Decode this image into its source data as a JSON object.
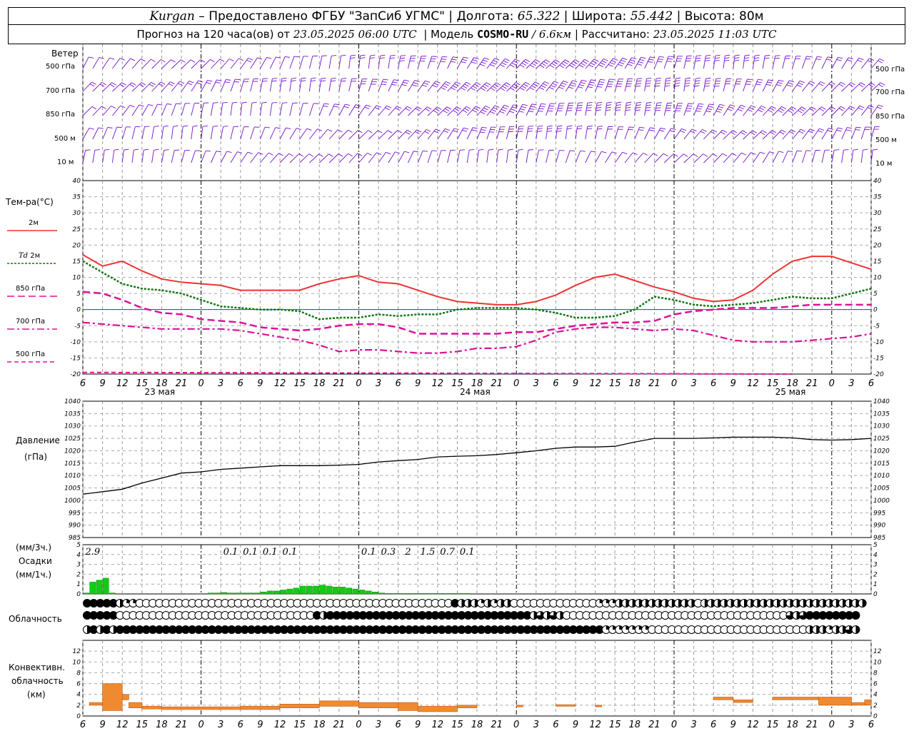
{
  "header": {
    "station": "Kurgan",
    "provider": "– Предоставлено ФГБУ \"ЗапСиб УГМС\"",
    "lon_label": "Долгота:",
    "lon": "65.322",
    "lat_label": "Широта:",
    "lat": "55.442",
    "alt_label": "Высота:",
    "alt": "80м",
    "forecast_label": "Прогноз на 120 часа(ов) от",
    "forecast_from": "23.05.2025 06:00 UTC",
    "model_label": "Модель",
    "model": "COSMO-RU",
    "resolution": "/ 6.6км",
    "calc_label": "Рассчитано:",
    "calc_time": "23.05.2025 11:03 UTC"
  },
  "labels": {
    "wind": "Ветер",
    "wind_levels": [
      "500 гПа",
      "700 гПа",
      "850 гПа",
      "500 м",
      "10 м"
    ],
    "temp": "Тем-ра(°C)",
    "t2m": "2м",
    "td": "Td",
    "td2m": "2м",
    "t850": "850 гПа",
    "t700": "700 гПа",
    "t500": "500 гПа",
    "pressure": "Давление",
    "pressure_unit": "(гПа)",
    "precip_unit1": "(мм/3ч.)",
    "precip": "Осадки",
    "precip_unit2": "(мм/1ч.)",
    "clouds": "Облачность",
    "conv1": "Конвективн.",
    "conv2": "облачность",
    "conv3": "(км)"
  },
  "colors": {
    "temp2m": "#ee3333",
    "dew": "#117711",
    "t850": "#dd1199",
    "wind": "#7711cc",
    "precip": "#11cc11",
    "conv": "#f08a30"
  },
  "time_axis": {
    "ticks": [
      "6",
      "9",
      "12",
      "15",
      "18",
      "21",
      "0",
      "3",
      "6",
      "9",
      "12",
      "15",
      "18",
      "21",
      "0",
      "3",
      "6",
      "9",
      "12",
      "15",
      "18",
      "21",
      "0",
      "3",
      "6",
      "9",
      "12"
    ],
    "dates": [
      "23 мая",
      "24 мая",
      "25 мая"
    ]
  },
  "chart_data": [
    {
      "type": "line",
      "name": "temperature",
      "x": [
        0,
        3,
        6,
        9,
        12,
        15,
        18,
        21,
        24,
        27,
        30,
        33,
        36,
        39,
        42,
        45,
        48,
        51,
        54,
        57,
        60,
        63,
        66,
        69,
        72,
        75,
        78,
        81,
        84,
        87,
        90,
        93,
        96,
        99,
        102,
        105,
        108,
        111,
        114,
        117,
        120
      ],
      "ylim": [
        -20,
        40
      ],
      "yticks": [
        -20,
        -15,
        -10,
        -5,
        0,
        5,
        10,
        15,
        20,
        25,
        30,
        35,
        40
      ],
      "series": [
        {
          "name": "2м",
          "values": [
            17,
            13.5,
            15,
            12,
            9.5,
            8.5,
            8,
            7.5,
            6,
            6,
            6,
            6,
            8,
            9.5,
            10.5,
            8.5,
            8,
            6,
            4,
            2.5,
            2,
            1.5,
            1.5,
            2.5,
            4.5,
            7.5,
            10,
            11,
            9,
            7,
            5.5,
            3.5,
            2.5,
            3,
            6,
            11,
            15,
            16.5,
            16.5,
            14.5,
            12.5
          ]
        },
        {
          "name": "Td 2м",
          "values": [
            15,
            11.5,
            8,
            6.5,
            6,
            5,
            3,
            1,
            0.5,
            0,
            0,
            -0.5,
            -3,
            -2.5,
            -2.5,
            -1.5,
            -2,
            -1.5,
            -1.5,
            0,
            0.5,
            0.5,
            0.5,
            0,
            -1,
            -2.5,
            -2.5,
            -2,
            0,
            4,
            3,
            1.5,
            1,
            1.5,
            2,
            3,
            4,
            3.5,
            3.5,
            5,
            6.5
          ]
        },
        {
          "name": "850 гПа",
          "values": [
            5.5,
            5,
            3,
            0.5,
            -1,
            -1.5,
            -3,
            -3.5,
            -4,
            -5.5,
            -6,
            -6.5,
            -6,
            -5,
            -4.5,
            -4.5,
            -5.5,
            -7.5,
            -7.5,
            -7.5,
            -7.5,
            -7.5,
            -7,
            -7,
            -6,
            -5,
            -4.5,
            -4,
            -4,
            -3.5,
            -1.5,
            -0.5,
            0,
            0.5,
            0.5,
            0.5,
            1,
            1.5,
            1.5,
            1.5,
            1.5
          ]
        },
        {
          "name": "700 гПа",
          "values": [
            -4,
            -4.5,
            -5,
            -5.5,
            -6,
            -6,
            -6,
            -6,
            -6.5,
            -7.5,
            -8.5,
            -9.5,
            -11,
            -13,
            -12.5,
            -12.5,
            -13,
            -13.5,
            -13.5,
            -13,
            -12,
            -12,
            -11.5,
            -9.5,
            -7,
            -6,
            -5.5,
            -5.5,
            -6,
            -6.5,
            -6,
            -6.5,
            -8,
            -9.5,
            -10,
            -10,
            -10,
            -9.5,
            -9,
            -8.5,
            -7.5
          ]
        },
        {
          "name": "500 гПа",
          "values": [
            -19.5,
            -20.5,
            -21,
            -21,
            -22,
            -22,
            -22,
            -22.5,
            -23,
            -23,
            -23,
            -23,
            -23,
            -23,
            -22.5,
            -22.5,
            -22.5,
            -22,
            -22,
            -22,
            -22,
            -22,
            -22,
            -22,
            -22,
            -22,
            -22,
            -22,
            -22,
            -21.5,
            -21.5,
            -21.5,
            -21,
            -21,
            -21,
            -20.5,
            -20,
            -20.5,
            -20.5,
            -20.5,
            -20.5
          ]
        }
      ]
    },
    {
      "type": "line",
      "name": "pressure",
      "x": [
        0,
        3,
        6,
        9,
        12,
        15,
        18,
        21,
        24,
        27,
        30,
        33,
        36,
        39,
        42,
        45,
        48,
        51,
        54,
        57,
        60,
        63,
        66,
        69,
        72,
        75,
        78,
        81,
        84,
        87,
        90,
        93,
        96,
        99,
        102,
        105,
        108,
        111,
        114,
        117,
        120
      ],
      "ylim": [
        985,
        1040
      ],
      "yticks": [
        985,
        990,
        995,
        1000,
        1005,
        1010,
        1015,
        1020,
        1025,
        1030,
        1035,
        1040
      ],
      "values": [
        1002.5,
        1003.5,
        1004.5,
        1007,
        1009,
        1011,
        1011.5,
        1012.5,
        1013,
        1013.5,
        1014,
        1014,
        1014,
        1014.2,
        1014.5,
        1015.5,
        1016,
        1016.5,
        1017.5,
        1017.8,
        1018,
        1018.5,
        1019.2,
        1020,
        1021,
        1021.5,
        1021.5,
        1021.8,
        1023.5,
        1025,
        1025,
        1025,
        1025.2,
        1025.5,
        1025.5,
        1025.5,
        1025.2,
        1024.5,
        1024.3,
        1024.5,
        1025
      ]
    },
    {
      "type": "bar",
      "name": "precipitation",
      "ylim": [
        0,
        5
      ],
      "yticks": [
        0,
        1,
        2,
        3,
        4,
        5
      ],
      "hourly_x": [
        1,
        2,
        3,
        4,
        5,
        20,
        21,
        22,
        23,
        24,
        25,
        26,
        27,
        28,
        29,
        30,
        31,
        32,
        33,
        34,
        35,
        36,
        37,
        38,
        39,
        40,
        41,
        42,
        43,
        44,
        45,
        46,
        47,
        48,
        49,
        50,
        51,
        52,
        53,
        54,
        55,
        56,
        57,
        58,
        59
      ],
      "hourly_values": [
        0.1,
        1.2,
        1.4,
        1.6,
        0.1,
        0.1,
        0.1,
        0.15,
        0.1,
        0.1,
        0.1,
        0.1,
        0.1,
        0.2,
        0.3,
        0.3,
        0.4,
        0.5,
        0.6,
        0.8,
        0.8,
        0.8,
        0.9,
        0.8,
        0.7,
        0.7,
        0.6,
        0.5,
        0.4,
        0.3,
        0.2,
        0.1,
        0.05,
        0.05,
        0.05,
        0.05,
        0.05,
        0.05,
        0.05,
        0.05,
        0.05,
        0.05,
        0.05,
        0.05,
        0.05
      ],
      "three_hour_labels": [
        {
          "x": 1.5,
          "label": "2.9"
        },
        {
          "x": 22.5,
          "label": "0.1"
        },
        {
          "x": 25.5,
          "label": "0.1"
        },
        {
          "x": 28.5,
          "label": "0.1"
        },
        {
          "x": 31.5,
          "label": "0.1"
        },
        {
          "x": 43.5,
          "label": "0.1"
        },
        {
          "x": 46.5,
          "label": "0.3"
        },
        {
          "x": 49.5,
          "label": "2"
        },
        {
          "x": 52.5,
          "label": "1.5"
        },
        {
          "x": 55.5,
          "label": "0.7"
        },
        {
          "x": 58.5,
          "label": "0.1"
        }
      ]
    },
    {
      "type": "bar",
      "name": "convective_clouds",
      "ylim": [
        0,
        14
      ],
      "yticks": [
        0,
        2,
        4,
        6,
        8,
        10,
        12
      ],
      "segments": [
        {
          "x0": 1,
          "x1": 3,
          "bottom": 2,
          "top": 2.5
        },
        {
          "x0": 3,
          "x1": 6,
          "bottom": 1,
          "top": 6
        },
        {
          "x0": 6,
          "x1": 7,
          "bottom": 3,
          "top": 4
        },
        {
          "x0": 7,
          "x1": 9,
          "bottom": 1.5,
          "top": 2.5
        },
        {
          "x0": 9,
          "x1": 12,
          "bottom": 1.3,
          "top": 1.8
        },
        {
          "x0": 12,
          "x1": 24,
          "bottom": 1.2,
          "top": 1.7
        },
        {
          "x0": 24,
          "x1": 30,
          "bottom": 1.2,
          "top": 1.8
        },
        {
          "x0": 30,
          "x1": 36,
          "bottom": 1.5,
          "top": 2.2
        },
        {
          "x0": 36,
          "x1": 42,
          "bottom": 1.8,
          "top": 2.8
        },
        {
          "x0": 42,
          "x1": 48,
          "bottom": 1.5,
          "top": 2.5
        },
        {
          "x0": 48,
          "x1": 51,
          "bottom": 1,
          "top": 2.5
        },
        {
          "x0": 51,
          "x1": 57,
          "bottom": 0.8,
          "top": 1.8
        },
        {
          "x0": 57,
          "x1": 60,
          "bottom": 1.5,
          "top": 2
        },
        {
          "x0": 66,
          "x1": 67,
          "bottom": 1.7,
          "top": 2
        },
        {
          "x0": 72,
          "x1": 75,
          "bottom": 1.8,
          "top": 2.1
        },
        {
          "x0": 78,
          "x1": 79,
          "bottom": 1.7,
          "top": 2
        },
        {
          "x0": 96,
          "x1": 99,
          "bottom": 3,
          "top": 3.5
        },
        {
          "x0": 99,
          "x1": 102,
          "bottom": 2.5,
          "top": 3
        },
        {
          "x0": 105,
          "x1": 112,
          "bottom": 3,
          "top": 3.5
        },
        {
          "x0": 112,
          "x1": 117,
          "bottom": 2,
          "top": 3.5
        },
        {
          "x0": 117,
          "x1": 119,
          "bottom": 2,
          "top": 2.5
        },
        {
          "x0": 119,
          "x1": 120,
          "bottom": 2,
          "top": 3
        }
      ]
    }
  ],
  "cloud_rows": {
    "rows": [
      "FFFFFHQQOOOOOOOOOOOOOOOOOOOOOOOOOOOOOOOOOOOOOOOOOOOOOOOOFHHHQHQHHOOOOOOOOOOOOOQQQHHHHHHHHHHHHOHHHHHHHHHHHHHHHHHHHHHHHHH",
      "FFFFFOOOOOOOOOOOOOOOOOOOOOOOOOOOOOOFHFFFFFFFFFFFFFFFFFFFFFFFFFFFFFFFHTHTHOOOOOOOOOOOOOOOOOOOOOOOOOOOOOOOOOOTHTFFFFFFFF",
      "HFHFHFFFFFFFFFFFFFFFFFFFFFFFFFFFFFFFFFFFFFFFFFFFFFFFFFFFFFFFFFFFFFFFFFFFFFFFFFFQQQQQQQOOOOOOOOOOOOOOOOOOOOOOOOHHHQHHTH"
    ]
  },
  "wind_rows": [
    [
      [
        0,
        5
      ],
      [
        12,
        10
      ],
      [
        24,
        15
      ],
      [
        36,
        10
      ],
      [
        48,
        25
      ],
      [
        60,
        35
      ],
      [
        72,
        35
      ],
      [
        84,
        35
      ],
      [
        96,
        30
      ],
      [
        108,
        20
      ],
      [
        120,
        15
      ]
    ],
    [
      [
        0,
        15
      ],
      [
        12,
        15
      ],
      [
        24,
        15
      ],
      [
        36,
        20
      ],
      [
        48,
        30
      ],
      [
        60,
        40
      ],
      [
        72,
        40
      ],
      [
        84,
        40
      ],
      [
        96,
        35
      ],
      [
        108,
        25
      ],
      [
        120,
        15
      ]
    ],
    [
      [
        0,
        10
      ],
      [
        12,
        10
      ],
      [
        24,
        10
      ],
      [
        36,
        15
      ],
      [
        48,
        20
      ],
      [
        60,
        35
      ],
      [
        72,
        35
      ],
      [
        84,
        35
      ],
      [
        96,
        35
      ],
      [
        108,
        25
      ],
      [
        120,
        15
      ]
    ],
    [
      [
        0,
        10
      ],
      [
        12,
        10
      ],
      [
        24,
        10
      ],
      [
        36,
        10
      ],
      [
        48,
        15
      ],
      [
        60,
        25
      ],
      [
        72,
        25
      ],
      [
        84,
        20
      ],
      [
        96,
        20
      ],
      [
        108,
        20
      ],
      [
        120,
        15
      ]
    ],
    [
      [
        0,
        5
      ],
      [
        12,
        5
      ],
      [
        24,
        5
      ],
      [
        36,
        5
      ],
      [
        48,
        5
      ],
      [
        60,
        10
      ],
      [
        72,
        10
      ],
      [
        84,
        10
      ],
      [
        96,
        10
      ],
      [
        108,
        10
      ],
      [
        120,
        5
      ]
    ]
  ]
}
